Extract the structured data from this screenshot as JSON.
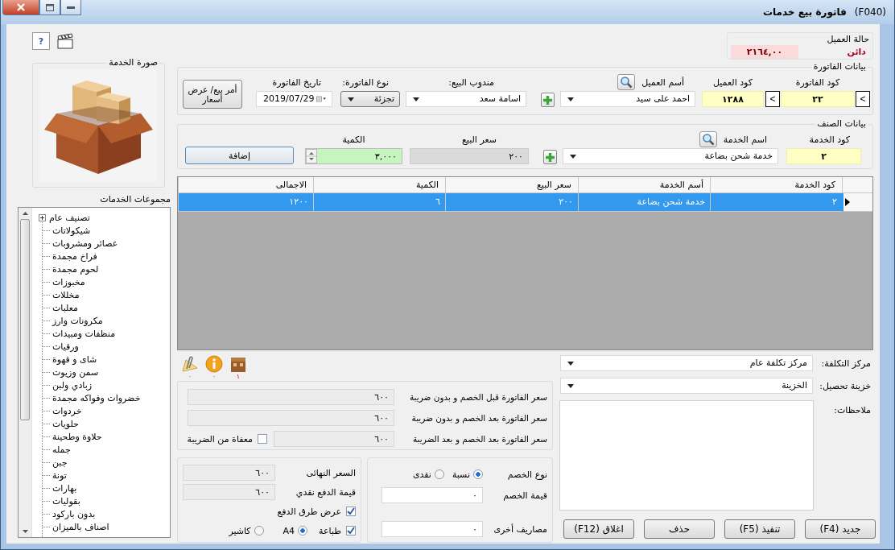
{
  "window": {
    "code": "(F040)",
    "title": "فاتورة بيع خدمات"
  },
  "toolbar": {
    "help": "?"
  },
  "customer_status": {
    "label": "حالة العميل",
    "balance": "٢١٦٤,٠٠",
    "state": "دائن"
  },
  "invoice": {
    "title": "بيانات الفاتورة",
    "invoice_code": {
      "label": "كود الفاتورة",
      "value": "٢٢",
      "next": "<",
      "prev": "<"
    },
    "customer_code": {
      "label": "كود العميل",
      "value": "١٢٨٨"
    },
    "customer_name": {
      "label": "أسم العميل",
      "value": "احمد على سيد"
    },
    "salesman": {
      "label": "مندوب البيع:",
      "value": "اسامة سعد"
    },
    "invoice_type": {
      "label": "نوع الفاتورة:",
      "value": "تجزئة"
    },
    "invoice_date": {
      "label": "تاريخ الفاتورة",
      "value": "2019/07/29"
    },
    "quote_button": "أمر بيع/ عرض أسعار"
  },
  "item": {
    "title": "بيانات الصنف",
    "service_code": {
      "label": "كود الخدمة",
      "value": "٢"
    },
    "service_name": {
      "label": "اسم الخدمة",
      "value": "خدمة شحن بضاعة"
    },
    "sale_price": {
      "label": "سعر البيع",
      "value": "٢٠٠"
    },
    "quantity": {
      "label": "الكمية",
      "value": "٣,٠٠٠"
    },
    "add_button": "إضافة"
  },
  "service_image": {
    "title": "صورة الخدمة",
    "kind": "picture"
  },
  "service_groups": {
    "title": "مجموعات الخدمات",
    "items": [
      {
        "label": "تصنيف عام",
        "kind": "branch"
      },
      {
        "label": "شيكولاتات",
        "kind": "leaf"
      },
      {
        "label": "عصائر ومشروبات",
        "kind": "leaf"
      },
      {
        "label": "فراخ مجمدة",
        "kind": "leaf"
      },
      {
        "label": "لحوم مجمدة",
        "kind": "leaf"
      },
      {
        "label": "مخبوزات",
        "kind": "leaf"
      },
      {
        "label": "مخللات",
        "kind": "leaf"
      },
      {
        "label": "معلبات",
        "kind": "leaf"
      },
      {
        "label": "مكرونات وارز",
        "kind": "leaf"
      },
      {
        "label": "منظفات ومبيدات",
        "kind": "leaf"
      },
      {
        "label": "ورقيات",
        "kind": "leaf"
      },
      {
        "label": "شاى و قهوة",
        "kind": "leaf"
      },
      {
        "label": "سمن وزيوت",
        "kind": "leaf"
      },
      {
        "label": "زبادي ولبن",
        "kind": "leaf"
      },
      {
        "label": "خضروات وفواكه مجمدة",
        "kind": "leaf"
      },
      {
        "label": "خردوات",
        "kind": "leaf"
      },
      {
        "label": "حلويات",
        "kind": "leaf"
      },
      {
        "label": "حلاوة وطحينة",
        "kind": "leaf"
      },
      {
        "label": "جمله",
        "kind": "leaf"
      },
      {
        "label": "جبن",
        "kind": "leaf"
      },
      {
        "label": "تونة",
        "kind": "leaf"
      },
      {
        "label": "بهارات",
        "kind": "leaf"
      },
      {
        "label": "بقوليات",
        "kind": "leaf"
      },
      {
        "label": "بدون باركود",
        "kind": "leaf"
      },
      {
        "label": "اصناف بالميزان",
        "kind": "leaf"
      }
    ]
  },
  "table": {
    "columns": [
      "كود الخدمة",
      "أسم الخدمة",
      "سعر البيع",
      "الكمية",
      "الاجمالى"
    ],
    "rows": [
      {
        "selected": true,
        "cells": [
          "٢",
          "خدمة شحن بضاعة",
          "٢٠٠",
          "٦",
          "١٢٠٠"
        ]
      }
    ]
  },
  "attachments": [
    {
      "kind": "box",
      "count": "١"
    },
    {
      "kind": "info",
      "count": "٠"
    },
    {
      "kind": "note",
      "count": "٠"
    }
  ],
  "totals": [
    {
      "label": "سعر الفاتورة قبل الخصم و بدون ضريبة",
      "value": "٦٠٠"
    },
    {
      "label": "سعر الفاتورة بعد الخصم و بدون ضريبة",
      "value": "٦٠٠"
    },
    {
      "label": "سعر الفاتورة بعد الخصم و بعد الضريبة",
      "value": "٦٠٠"
    }
  ],
  "tax_exempt": {
    "label": "معفاة من الضريبة",
    "checked": false
  },
  "payment": {
    "final_price": {
      "label": "السعر النهائى",
      "value": "٦٠٠"
    },
    "cash_payment": {
      "label": "قيمة الدفع نقدي",
      "value": "٦٠٠"
    },
    "show_payment_methods": {
      "label": "عرض طرق الدفع",
      "checked": true
    },
    "print": {
      "label": "طباعة",
      "checked": true
    },
    "print_format": [
      {
        "label": "A4",
        "selected": true
      },
      {
        "label": "كاشير",
        "selected": false
      }
    ]
  },
  "discount": {
    "type_label": "نوع الخصم",
    "types": [
      {
        "label": "نسبة",
        "selected": true
      },
      {
        "label": "نقدى",
        "selected": false
      }
    ],
    "value": {
      "label": "قيمة الخصم",
      "value": "٠"
    },
    "other_expenses": {
      "label": "مصاريف أخرى",
      "value": "٠"
    }
  },
  "cost_center": {
    "label": "مركز التكلفة:",
    "value": "مركز تكلفة عام"
  },
  "treasury": {
    "label": "خزينة تحصيل:",
    "value": "الخزينة"
  },
  "notes": {
    "label": "ملاحظات:"
  },
  "buttons": [
    "جديد (F4)",
    "تنفيذ (F5)",
    "حذف",
    "اغلاق (F12)"
  ]
}
